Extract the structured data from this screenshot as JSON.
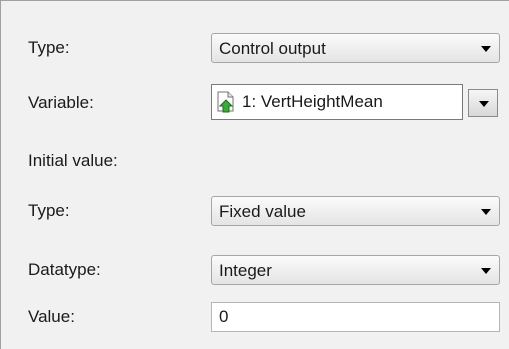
{
  "form": {
    "type_label": "Type:",
    "type_value": "Control output",
    "variable_label": "Variable:",
    "variable_value": "1: VertHeightMean",
    "variable_icon": "document-arrow-icon",
    "initial_value_heading": "Initial value:",
    "init_type_label": "Type:",
    "init_type_value": "Fixed value",
    "datatype_label": "Datatype:",
    "datatype_value": "Integer",
    "value_label": "Value:",
    "value_value": "0"
  }
}
